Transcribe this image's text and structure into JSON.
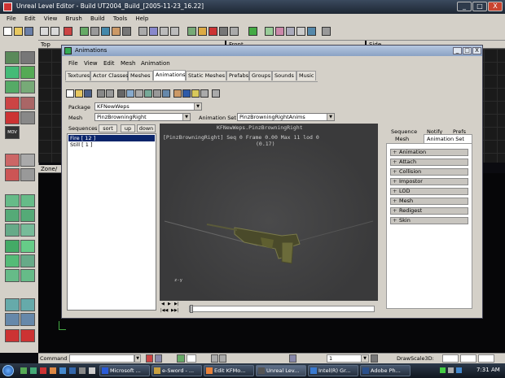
{
  "window": {
    "title": "Unreal Level Editor - Build UT2004_Build_[2005-11-23_16.22]",
    "controls": [
      "_",
      "□",
      "X"
    ]
  },
  "menubar": [
    "File",
    "Edit",
    "View",
    "Brush",
    "Build",
    "Tools",
    "Help"
  ],
  "viewports": {
    "top_label": "Top",
    "front_label": "Front",
    "side_label": "Side",
    "zone_label": "Zone/"
  },
  "animations_window": {
    "title": "Animations",
    "controls": [
      "_",
      "□",
      "X"
    ],
    "menu": [
      "File",
      "View",
      "Edit",
      "Mesh",
      "Animation"
    ],
    "tabs": [
      "Textures",
      "Actor Classes",
      "Meshes",
      "Animations",
      "Static Meshes",
      "Prefabs",
      "Groups",
      "Sounds",
      "Music"
    ],
    "active_tab": "Animations",
    "package_label": "Package",
    "package_value": "KFNewWeps",
    "mesh_label": "Mesh",
    "mesh_value": "PinzBrowningRight",
    "animset_label": "Animation Set",
    "animset_value": "PinzBrowningRightAnims",
    "sequences_label": "Sequences",
    "sort_button": "sort",
    "up_button": "up",
    "down_button": "down",
    "sequences": [
      "Fire  [ 12 ]",
      "Still  [ 1 ]"
    ],
    "selected_sequence": "Fire  [ 12 ]",
    "viewer": {
      "overlay_title": "KFNewWeps.PinzBrowningRight",
      "overlay_line": "[PinzBrowningRight] Seq 0  Frame  0.00 Max 11  lod 0",
      "overlay_sub": "(0.17)",
      "axis_label": "z-y"
    },
    "playback": {
      "top_row": [
        "◀",
        "▶",
        "▶|"
      ],
      "bottom_row": [
        "|◀◀",
        "▶▶|"
      ]
    },
    "right_tabs_row1": [
      "Sequence",
      "Notify",
      "Prefs"
    ],
    "right_tabs_row2": [
      "Mesh",
      "Animation Set"
    ],
    "properties": [
      "Animation",
      "Attach",
      "Collision",
      "Impostor",
      "LOD",
      "Mesh",
      "Redigest",
      "Skin"
    ]
  },
  "command_bar": {
    "label": "Command :",
    "zoom_value": "1",
    "drawscale_label": "DrawScale3D:"
  },
  "taskbar": {
    "items": [
      "Microsoft ...",
      "e-Sword - ...",
      "Edit KFMo...",
      "Unreal Lev...",
      "Intel(R) Gr...",
      "Adobe Ph..."
    ],
    "clock": "7:31 AM"
  },
  "colors": {
    "chrome": "#d4d0c8",
    "title_bar": "#1d2633",
    "selection": "#0a246a",
    "viewer_bg": "#3f3f40"
  }
}
